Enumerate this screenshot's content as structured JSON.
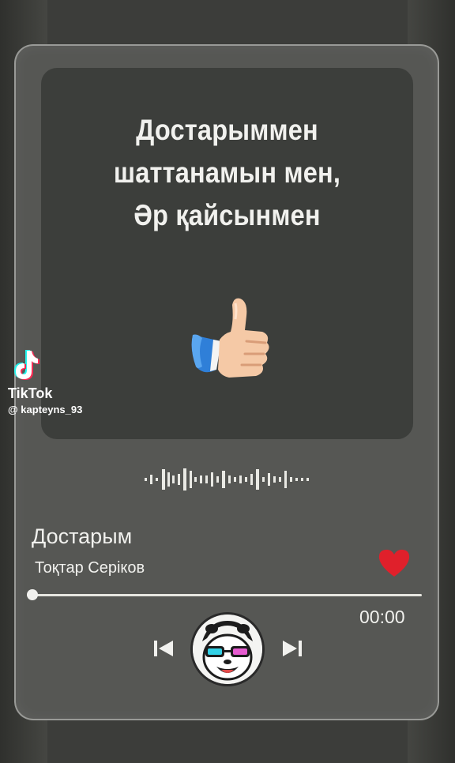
{
  "lyrics": {
    "lines": [
      "Достарыммен",
      "шаттанамын мен,",
      "Әр қайсынмен"
    ]
  },
  "watermark": {
    "brand": "TikTok",
    "username": "@ kapteyns_93"
  },
  "player": {
    "song_title": "Достарым",
    "artist": "Тоқтар Серіков",
    "time": "00:00",
    "progress": 0,
    "liked": true,
    "accent_color": "#e0202b"
  },
  "icons": {
    "thumb": "thumbs-up-icon",
    "heart": "heart-icon",
    "prev": "skip-previous-icon",
    "next": "skip-next-icon",
    "avatar": "panda-avatar",
    "wave": "audio-waveform-icon"
  }
}
